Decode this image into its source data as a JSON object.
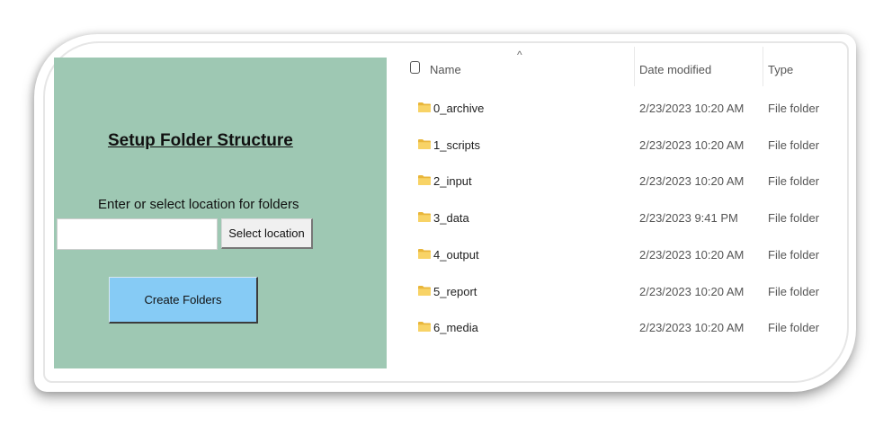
{
  "setup_panel": {
    "title": "Setup Folder Structure",
    "prompt": "Enter or select location for folders",
    "location_value": "",
    "select_location_label": "Select location",
    "create_folders_label": "Create Folders"
  },
  "explorer": {
    "columns": {
      "name": "Name",
      "date_modified": "Date modified",
      "type": "Type"
    },
    "sort_indicator": "^",
    "colors": {
      "panel_bg": "#9ec8b3",
      "create_button_bg": "#86cbf5",
      "folder_icon": "#f5c542"
    },
    "rows": [
      {
        "name": "0_archive",
        "date": "2/23/2023 10:20 AM",
        "type": "File folder",
        "icon": "folder-icon"
      },
      {
        "name": "1_scripts",
        "date": "2/23/2023 10:20 AM",
        "type": "File folder",
        "icon": "folder-icon"
      },
      {
        "name": "2_input",
        "date": "2/23/2023 10:20 AM",
        "type": "File folder",
        "icon": "folder-icon"
      },
      {
        "name": "3_data",
        "date": "2/23/2023 9:41 PM",
        "type": "File folder",
        "icon": "folder-icon"
      },
      {
        "name": "4_output",
        "date": "2/23/2023 10:20 AM",
        "type": "File folder",
        "icon": "folder-icon"
      },
      {
        "name": "5_report",
        "date": "2/23/2023 10:20 AM",
        "type": "File folder",
        "icon": "folder-icon"
      },
      {
        "name": "6_media",
        "date": "2/23/2023 10:20 AM",
        "type": "File folder",
        "icon": "folder-icon"
      }
    ]
  }
}
